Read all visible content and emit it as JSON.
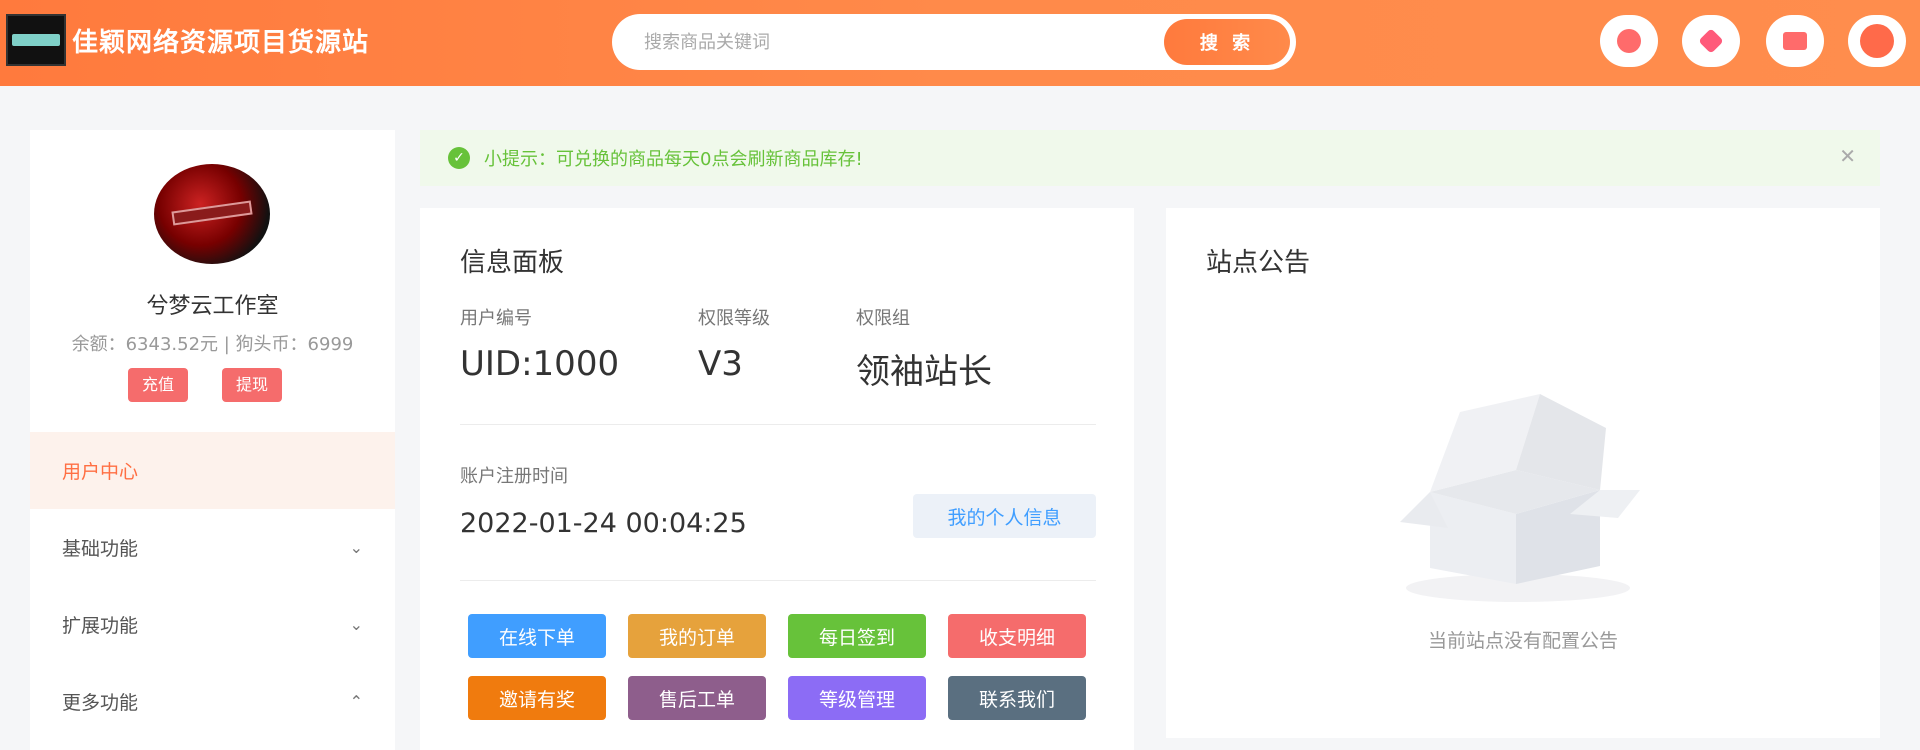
{
  "header": {
    "site_title": "佳颖网络资源项目货源站",
    "search_placeholder": "搜索商品关键词",
    "search_button": "搜 索",
    "icons": [
      "smile-icon",
      "heart-icon",
      "card-icon",
      "user-icon"
    ]
  },
  "sidebar": {
    "user_name": "兮梦云工作室",
    "balance": "余额：6343.52元 | 狗头币：6999",
    "recharge_button": "充值",
    "withdraw_button": "提现",
    "menu": [
      {
        "label": "用户中心",
        "active": true
      },
      {
        "label": "基础功能",
        "expanded": false
      },
      {
        "label": "扩展功能",
        "expanded": false
      },
      {
        "label": "更多功能",
        "expanded": true
      }
    ]
  },
  "tip": {
    "text": "小提示：可兑换的商品每天0点会刷新商品库存!"
  },
  "info_panel": {
    "title": "信息面板",
    "fields": [
      {
        "label": "用户编号",
        "value": "UID:1000"
      },
      {
        "label": "权限等级",
        "value": "V3"
      },
      {
        "label": "权限组",
        "value": "领袖站长"
      }
    ],
    "reg_label": "账户注册时间",
    "reg_value": "2022-01-24 00:04:25",
    "profile_button": "我的个人信息",
    "actions": [
      {
        "label": "在线下单",
        "color": "#409eff"
      },
      {
        "label": "我的订单",
        "color": "#e6a23c"
      },
      {
        "label": "每日签到",
        "color": "#67c23a"
      },
      {
        "label": "收支明细",
        "color": "#f56c6c"
      },
      {
        "label": "邀请有奖",
        "color": "#f07b0e"
      },
      {
        "label": "售后工单",
        "color": "#8e5e8c"
      },
      {
        "label": "等级管理",
        "color": "#8c6cf5"
      },
      {
        "label": "联系我们",
        "color": "#5a6f80"
      }
    ]
  },
  "notice_panel": {
    "title": "站点公告",
    "empty_text": "当前站点没有配置公告"
  },
  "colors": {
    "brand": "#ff7a3d",
    "active_menu_text": "#ff6f43",
    "tip_green": "#67c23a"
  }
}
